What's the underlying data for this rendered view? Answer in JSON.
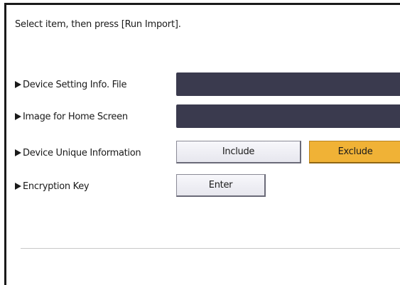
{
  "instruction": "Select item, then press [Run Import].",
  "rows": [
    {
      "label": "Device Setting Info. File",
      "type": "field"
    },
    {
      "label": "Image for Home Screen",
      "type": "field"
    },
    {
      "label": "Device Unique Information",
      "type": "choice",
      "options": [
        "Include",
        "Exclude"
      ],
      "selected": "Exclude"
    },
    {
      "label": "Encryption Key",
      "type": "button",
      "button_label": "Enter"
    }
  ],
  "colors": {
    "field_dark": "#3a3a4e",
    "selected": "#f0b236",
    "button_face": "#ececf2"
  }
}
